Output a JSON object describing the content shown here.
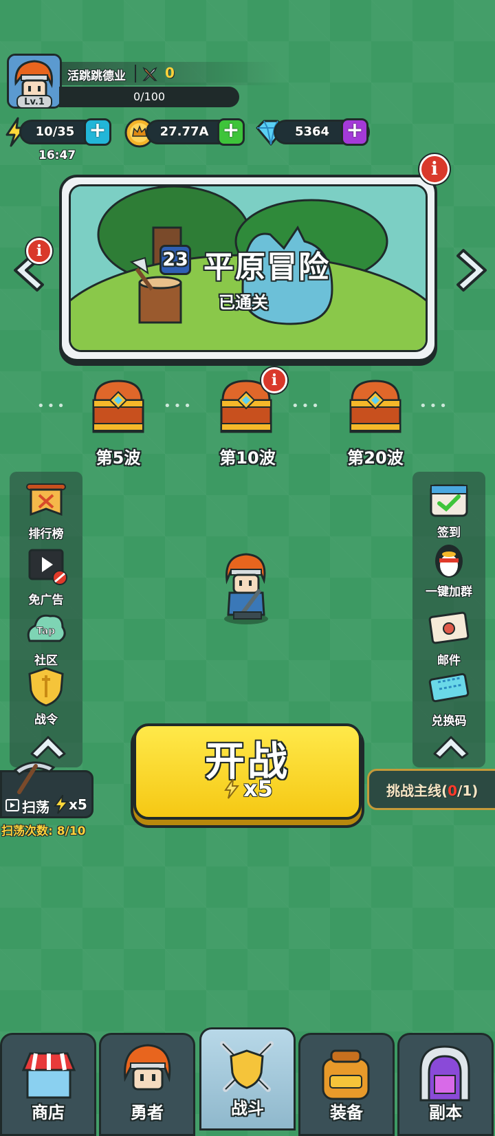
{
  "player": {
    "name": "活跳跳德业",
    "level": "Lv.1",
    "power": "0",
    "xp": "0/100"
  },
  "resources": {
    "energy": "10/35",
    "gold": "27.77A",
    "diamonds": "5364",
    "timer": "16:47"
  },
  "stage": {
    "number": "23",
    "name": "平原冒险",
    "status": "已通关"
  },
  "chests": [
    {
      "label": "第5波"
    },
    {
      "label": "第10波"
    },
    {
      "label": "第20波"
    }
  ],
  "left_menu": [
    {
      "label": "排行榜",
      "icon": "ranking-banner-icon"
    },
    {
      "label": "免广告",
      "icon": "no-ads-icon"
    },
    {
      "label": "社区",
      "icon": "tap-community-icon",
      "icon_text": "Tap"
    },
    {
      "label": "战令",
      "icon": "battle-pass-shield-icon"
    }
  ],
  "right_menu": [
    {
      "label": "签到",
      "icon": "check-in-calendar-icon"
    },
    {
      "label": "一键加群",
      "icon": "qq-penguin-icon"
    },
    {
      "label": "邮件",
      "icon": "mail-envelope-icon"
    },
    {
      "label": "兑换码",
      "icon": "redeem-ticket-icon"
    }
  ],
  "fight": {
    "label": "开战",
    "cost": "x5"
  },
  "sweep": {
    "label": "扫荡",
    "cost": "x5",
    "count_label": "扫荡次数: 8/10"
  },
  "mainline": {
    "prefix": "挑战主线(",
    "current": "0",
    "suffix": "/1)"
  },
  "nav": [
    {
      "label": "商店",
      "icon": "shop-icon"
    },
    {
      "label": "勇者",
      "icon": "hero-icon"
    },
    {
      "label": "战斗",
      "icon": "battle-icon",
      "active": true
    },
    {
      "label": "装备",
      "icon": "equipment-bag-icon"
    },
    {
      "label": "副本",
      "icon": "dungeon-gate-icon"
    }
  ],
  "colors": {
    "background": "#3d9a63",
    "fight_button": "#f5c814",
    "info_badge": "#d9392b",
    "energy_plus": "#22b6d8",
    "gold_plus": "#3ec43a",
    "diamond_plus": "#a43ad8"
  }
}
